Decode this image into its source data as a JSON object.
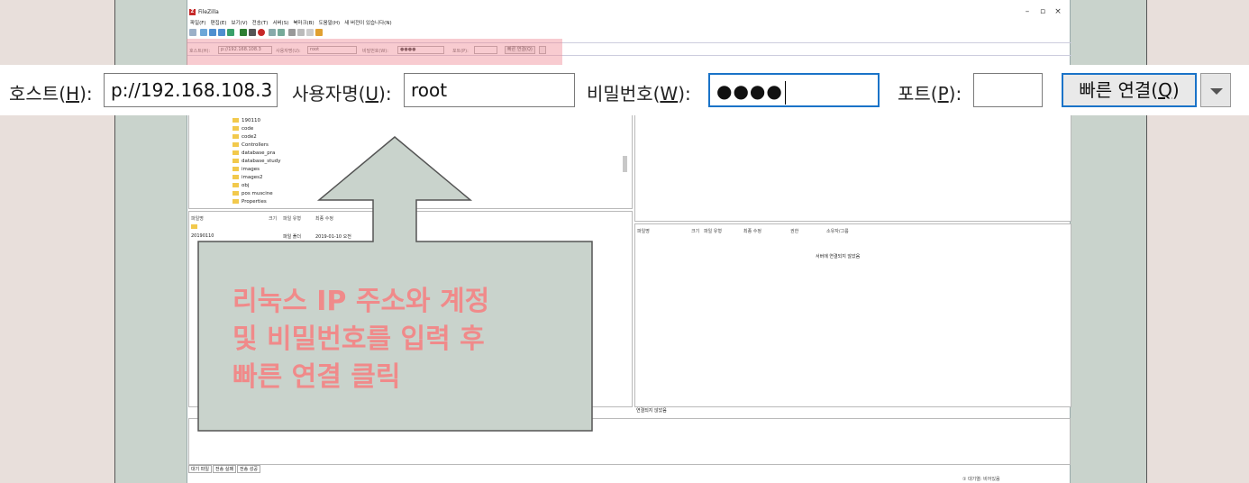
{
  "window": {
    "title": "FileZilla",
    "controls": [
      "–",
      "▫",
      "×"
    ]
  },
  "menu": [
    "파일(F)",
    "편집(E)",
    "보기(V)",
    "전송(T)",
    "서버(S)",
    "북마크(B)",
    "도움말(H)",
    "새 버전이 있습니다(N)"
  ],
  "quickconnect_small": {
    "host_label": "호스트(H):",
    "host_value": "p://192.168.108.3",
    "user_label": "사용자명(U):",
    "user_value": "root",
    "pass_label": "비밀번호(W):",
    "pass_value": "●●●●",
    "port_label": "포트(P):",
    "button": "빠른 연결(Q)"
  },
  "quickconnect": {
    "host_label_pre": "호스트(",
    "host_label_key": "H",
    "host_label_post": "):",
    "host_value": "p://192.168.108.3",
    "user_label_pre": "사용자명(",
    "user_label_key": "U",
    "user_label_post": "):",
    "user_value": "root",
    "pass_label_pre": "비밀번호(",
    "pass_label_key": "W",
    "pass_label_post": "):",
    "pass_value": "●●●●",
    "port_label_pre": "포트(",
    "port_label_key": "P",
    "port_label_post": "):",
    "port_value": "",
    "button_pre": "빠른 연결(",
    "button_key": "Q",
    "button_post": ")"
  },
  "local_tree": [
    "190110",
    "code",
    "code2",
    "Controllers",
    "database_pra",
    "database_study",
    "images",
    "images2",
    "obj",
    "pos muscine",
    "Properties"
  ],
  "local_columns": [
    "파일명",
    "크기",
    "파일 유형",
    "최종 수정"
  ],
  "local_rows": [
    {
      "name": "20190110",
      "size": "",
      "type": "파일 폴더",
      "modified": "2019-01-10 오전"
    }
  ],
  "remote_columns": [
    "파일명",
    "크기",
    "파일 유형",
    "최종 수정",
    "권한",
    "소유자/그룹"
  ],
  "remote_message": "서버에 연결되지 않았음",
  "remote_status": "연결되지 않았음",
  "callout": {
    "line1": "리눅스 IP 주소와 계정",
    "line2": "및 비밀번호를 입력 후",
    "line3": "빠른 연결 클릭"
  },
  "queue_tabs": [
    "대기 파일",
    "전송 실패",
    "전송 성공"
  ],
  "statusbar": "① 대기열: 비어있음",
  "colors": {
    "callout_fill": "#c9d3cc",
    "callout_text": "#f08a8a",
    "focus_border": "#1a73c8",
    "highlight": "#f08c96"
  }
}
